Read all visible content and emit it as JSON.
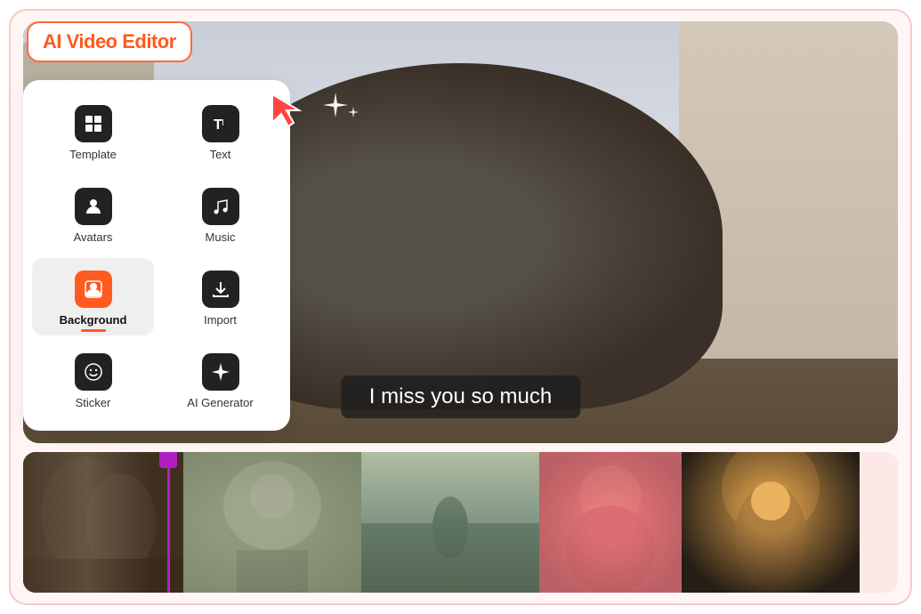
{
  "app": {
    "title": "AI Video Editor"
  },
  "sidebar": {
    "items": [
      {
        "id": "template",
        "label": "Template",
        "icon": "template-icon",
        "active": false
      },
      {
        "id": "text",
        "label": "Text",
        "icon": "text-icon",
        "active": false
      },
      {
        "id": "avatars",
        "label": "Avatars",
        "icon": "avatars-icon",
        "active": false
      },
      {
        "id": "music",
        "label": "Music",
        "icon": "music-icon",
        "active": false
      },
      {
        "id": "background",
        "label": "Background",
        "icon": "background-icon",
        "active": true
      },
      {
        "id": "import",
        "label": "Import",
        "icon": "import-icon",
        "active": false
      },
      {
        "id": "sticker",
        "label": "Sticker",
        "icon": "sticker-icon",
        "active": false
      },
      {
        "id": "ai-generator",
        "label": "AI Generator",
        "icon": "ai-generator-icon",
        "active": false
      }
    ]
  },
  "video": {
    "subtitle": "I miss you so much"
  },
  "timeline": {
    "clips": [
      {
        "id": 1,
        "type": "couple-hug"
      },
      {
        "id": 2,
        "type": "boy-dog"
      },
      {
        "id": 3,
        "type": "field-couple"
      },
      {
        "id": 4,
        "type": "couple-hug-2"
      },
      {
        "id": 5,
        "type": "anime-girl"
      }
    ]
  }
}
